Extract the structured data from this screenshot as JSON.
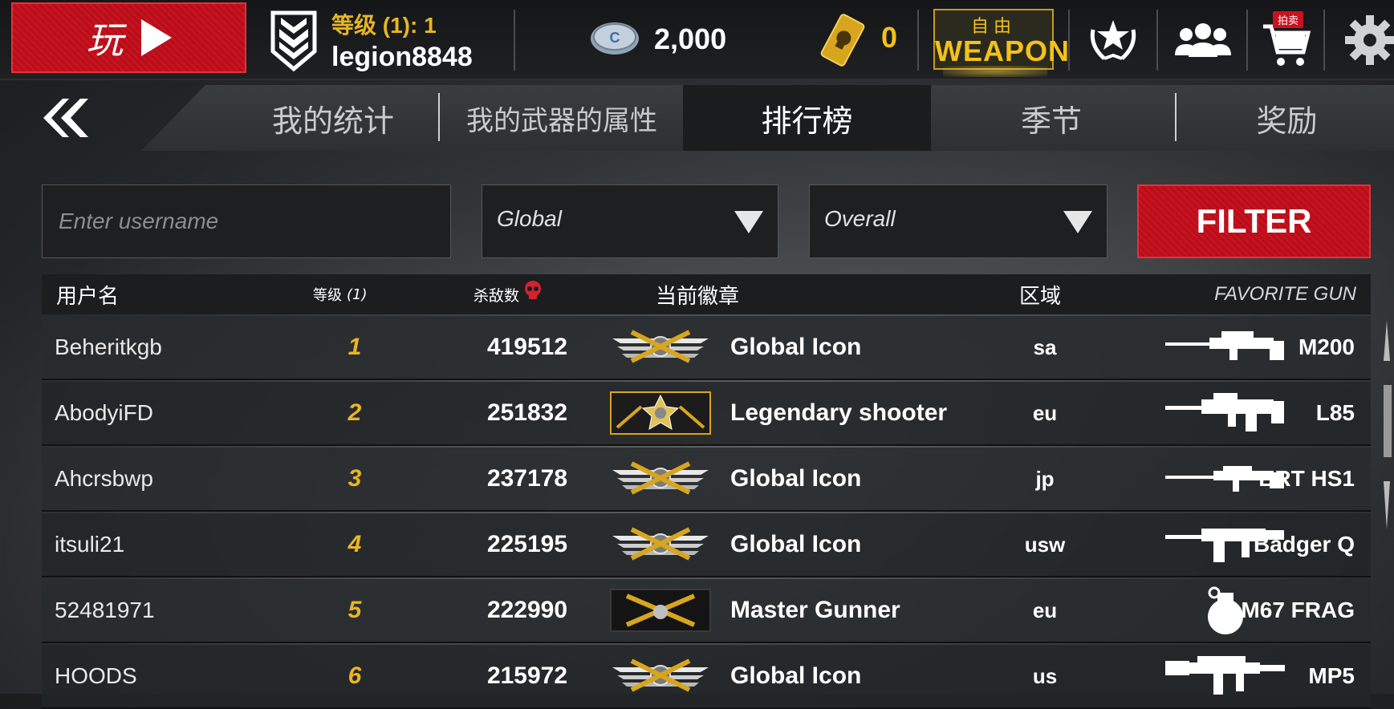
{
  "topbar": {
    "play_label": "玩",
    "rank_line": "等级 (1): 1",
    "username": "legion8848",
    "coins": "2,000",
    "gold": "0",
    "weapon_top": "自由",
    "weapon_bottom": "WEAPON",
    "auction_tag": "拍卖",
    "icons": [
      "play-icon",
      "rank-chevron-icon",
      "coin-icon",
      "gold-skull-icon",
      "laurel-star-icon",
      "friends-icon",
      "cart-icon",
      "gear-icon"
    ]
  },
  "tabs": [
    {
      "label": "我的统计",
      "active": false
    },
    {
      "label": "我的武器的属性",
      "active": false
    },
    {
      "label": "排行榜",
      "active": true
    },
    {
      "label": "季节",
      "active": false
    },
    {
      "label": "奖励",
      "active": false
    }
  ],
  "filters": {
    "username_placeholder": "Enter username",
    "region": "Global",
    "mode": "Overall",
    "filter_label": "FILTER"
  },
  "table": {
    "headers": {
      "user": "用户名",
      "level": "等级",
      "level_sub": "(1)",
      "kills": "杀敌数",
      "badge": "当前徽章",
      "region": "区域",
      "gun": "FAVORITE GUN"
    },
    "rows": [
      {
        "user": "Beheritkgb",
        "level": "1",
        "kills": "419512",
        "badge": "Global Icon",
        "badge_type": "global",
        "region": "sa",
        "gun": "M200",
        "gun_icon": "sniper-rifle-icon"
      },
      {
        "user": "AbodyiFD",
        "level": "2",
        "kills": "251832",
        "badge": "Legendary shooter",
        "badge_type": "legendary",
        "region": "eu",
        "gun": "L85",
        "gun_icon": "bullpup-rifle-icon"
      },
      {
        "user": "Ahcrsbwp",
        "level": "3",
        "kills": "237178",
        "badge": "Global Icon",
        "badge_type": "global",
        "region": "jp",
        "gun": "BRT HS1",
        "gun_icon": "long-rifle-icon"
      },
      {
        "user": "itsuli21",
        "level": "4",
        "kills": "225195",
        "badge": "Global Icon",
        "badge_type": "global",
        "region": "usw",
        "gun": "Badger Q",
        "gun_icon": "assault-rifle-icon"
      },
      {
        "user": "52481971",
        "level": "5",
        "kills": "222990",
        "badge": "Master Gunner",
        "badge_type": "master",
        "region": "eu",
        "gun": "M67 FRAG",
        "gun_icon": "grenade-icon"
      },
      {
        "user": "HOODS",
        "level": "6",
        "kills": "215972",
        "badge": "Global Icon",
        "badge_type": "global",
        "region": "us",
        "gun": "MP5",
        "gun_icon": "smg-icon"
      }
    ]
  },
  "colors": {
    "accent_red": "#c8121f",
    "gold": "#e9b524",
    "header_bg": "#151618"
  }
}
